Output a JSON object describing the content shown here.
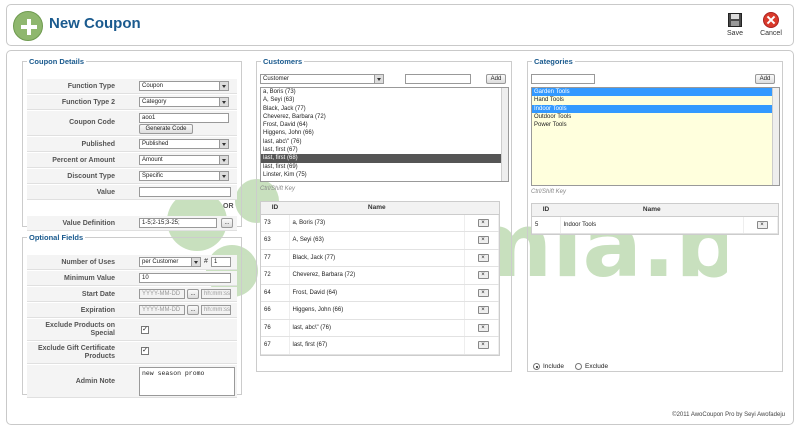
{
  "header": {
    "title": "New Coupon",
    "save_label": "Save",
    "cancel_label": "Cancel"
  },
  "coupon_details": {
    "legend": "Coupon Details",
    "function_type": {
      "label": "Function Type",
      "value": "Coupon"
    },
    "function_type2": {
      "label": "Function Type 2",
      "value": "Category"
    },
    "coupon_code": {
      "label": "Coupon Code",
      "value": "aoo1",
      "button": "Generate Code"
    },
    "published": {
      "label": "Published",
      "value": "Published"
    },
    "percent_amount": {
      "label": "Percent or Amount",
      "value": "Amount"
    },
    "discount_type": {
      "label": "Discount Type",
      "value": "Specific"
    },
    "value": {
      "label": "Value",
      "value": ""
    },
    "or_text": "OR",
    "value_definition": {
      "label": "Value Definition",
      "value": "1-5;2-15;3-25;",
      "button": "..."
    }
  },
  "optional_fields": {
    "legend": "Optional Fields",
    "number_of_uses": {
      "label": "Number of Uses",
      "value": "per Customer",
      "hash": "#",
      "count": "1"
    },
    "minimum_value": {
      "label": "Minimum Value",
      "value": "10"
    },
    "start_date": {
      "label": "Start Date",
      "date_placeholder": "YYYY-MM-DD",
      "time_placeholder": "hh:mm:ss",
      "button": "..."
    },
    "expiration": {
      "label": "Expiration",
      "date_placeholder": "YYYY-MM-DD",
      "time_placeholder": "hh:mm:ss",
      "button": "..."
    },
    "exclude_special": {
      "label": "Exclude Products on Special",
      "checked": "✓"
    },
    "exclude_gift": {
      "label": "Exclude Gift Certificate Products",
      "checked": "✓"
    },
    "admin_note": {
      "label": "Admin Note",
      "value": "new season promo"
    }
  },
  "customers": {
    "legend": "Customers",
    "type_select": "Customer",
    "add_label": "Add",
    "search_value": "",
    "list": [
      "a, Boris (73)",
      "A, Seyi (63)",
      "Black, Jack (77)",
      "Cheverez, Barbara (72)",
      "Frost, David (64)",
      "Higgens, John (66)",
      "last, abc\\\" (76)",
      "last, first (67)",
      "last, first (68)",
      "last, first (69)",
      "Linster, Kim (75)"
    ],
    "hint": "Ctrl/Shift Key",
    "table_headers": {
      "id": "ID",
      "name": "Name"
    },
    "rows": [
      {
        "id": "73",
        "name": "a, Boris (73)"
      },
      {
        "id": "63",
        "name": "A, Seyi (63)"
      },
      {
        "id": "77",
        "name": "Black, Jack (77)"
      },
      {
        "id": "72",
        "name": "Cheverez, Barbara (72)"
      },
      {
        "id": "64",
        "name": "Frost, David (64)"
      },
      {
        "id": "66",
        "name": "Higgens, John (66)"
      },
      {
        "id": "76",
        "name": "last, abc\\\" (76)"
      },
      {
        "id": "67",
        "name": "last, first (67)"
      }
    ],
    "delete_glyph": "×"
  },
  "categories": {
    "legend": "Categories",
    "add_label": "Add",
    "search_value": "",
    "list": [
      "Garden Tools",
      "Hand Tools",
      "Indoor Tools",
      "Outdoor Tools",
      "Power Tools"
    ],
    "hint": "Ctrl/Shift Key",
    "table_headers": {
      "id": "ID",
      "name": "Name"
    },
    "rows": [
      {
        "id": "5",
        "name": "Indoor Tools"
      }
    ],
    "delete_glyph": "×",
    "include_label": "Include",
    "exclude_label": "Exclude"
  },
  "watermark_text": "Joomla.bid",
  "footer": "©2011 AwoCoupon Pro by Seyi Awofadeju",
  "colors": {
    "title": "#1a5a8e",
    "selection_dark": "#555555",
    "selection_blue": "#3399ff",
    "list_yellow": "#ffffdd",
    "watermark": "#9cc78a"
  }
}
